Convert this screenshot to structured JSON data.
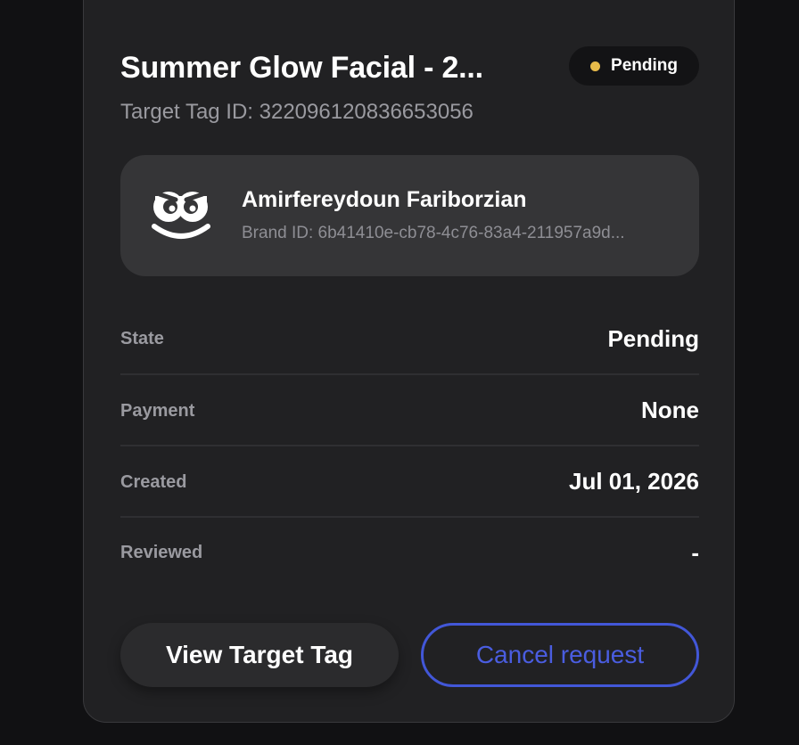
{
  "header": {
    "title": "Summer Glow Facial - 2...",
    "status_label": "Pending",
    "status_color": "#e8bb4a",
    "target_tag_line": "Target Tag ID: 322096120836653056"
  },
  "brand": {
    "logo_icon": "smiley-face-icon",
    "name": "Amirfereydoun Fariborzian",
    "id_line": "Brand ID: 6b41410e-cb78-4c76-83a4-211957a9d..."
  },
  "details": [
    {
      "label": "State",
      "value": "Pending"
    },
    {
      "label": "Payment",
      "value": "None"
    },
    {
      "label": "Created",
      "value": "Jul 01, 2026"
    },
    {
      "label": "Reviewed",
      "value": "-"
    }
  ],
  "actions": {
    "view_label": "View Target Tag",
    "cancel_label": "Cancel request",
    "cancel_color": "#4257d8"
  }
}
